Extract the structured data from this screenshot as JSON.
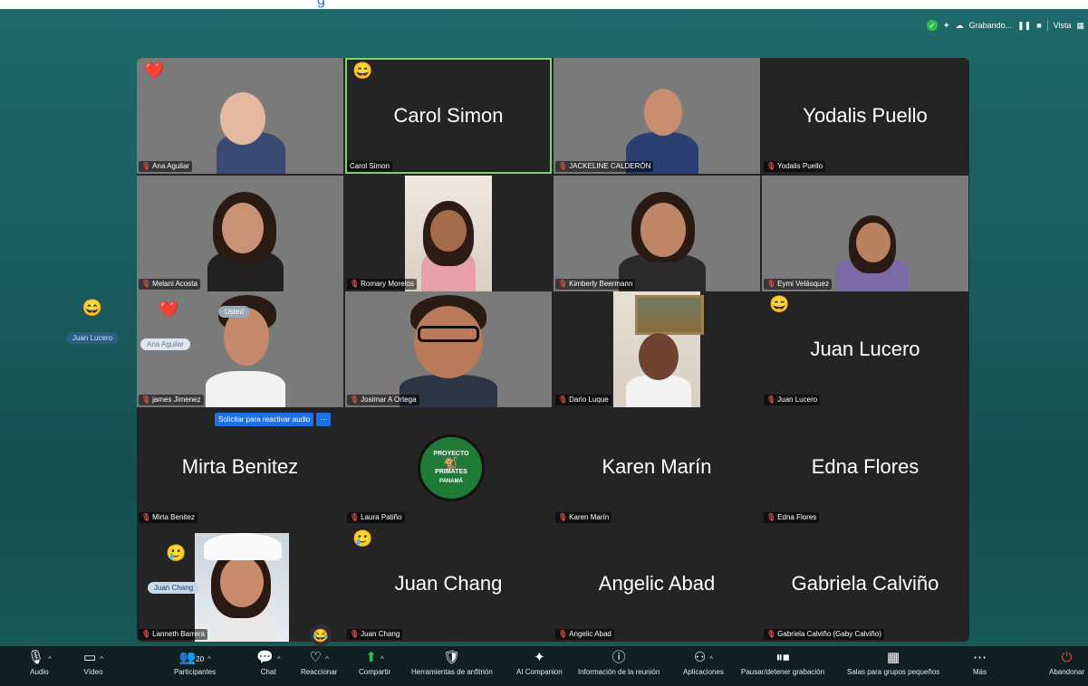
{
  "top_strip": {
    "text": "g"
  },
  "top_bar": {
    "recording_label": "Grabando...",
    "view_label": "Vista"
  },
  "participants": [
    {
      "display": "Ana Aguilar",
      "name": "Ana Aguilar",
      "muted": true,
      "video": true,
      "reaction": "❤️"
    },
    {
      "display": "Carol Simon",
      "name": "Carol Simon",
      "muted": false,
      "video": false,
      "reaction": "😄",
      "speaking": true
    },
    {
      "display": "JACKELINE CALDERÓN",
      "name": "JACKELINE CALDERÓN",
      "muted": true,
      "video": true
    },
    {
      "display": "Yodalis Puello",
      "name": "Yodalis Puello",
      "muted": true,
      "video": false
    },
    {
      "display": "Melani Acosta",
      "name": "Melani Acosta",
      "muted": true,
      "video": true
    },
    {
      "display": "Romary Morelos",
      "name": "Romary Morelos",
      "muted": true,
      "video": true
    },
    {
      "display": "Kimberly Beermann",
      "name": "Kimberly Beermann",
      "muted": true,
      "video": true
    },
    {
      "display": "Eymi Velásquez",
      "name": "Eymi Velásquez",
      "muted": true,
      "video": true
    },
    {
      "display": "james Jimenez",
      "name": "james Jimenez",
      "muted": true,
      "video": true,
      "reaction": "❤️",
      "overlay_top": "Usted",
      "overlay_sub": "Ana Aguilar"
    },
    {
      "display": "Josimar A Ortega",
      "name": "Josimar A Ortega",
      "muted": true,
      "video": true
    },
    {
      "display": "Dario Luque",
      "name": "Dario Luque",
      "muted": true,
      "video": true
    },
    {
      "display": "Juan Lucero",
      "name": "Juan Lucero",
      "muted": true,
      "video": false,
      "reaction": "😄"
    },
    {
      "display": "Mirta Benitez",
      "name": "Mirta Benitez",
      "muted": true,
      "video": false
    },
    {
      "display": "Laura Patiño",
      "name": "Laura Patiño",
      "muted": true,
      "video": false,
      "logo": [
        "PROYECTO",
        "PRIMATES",
        "PANAMÁ"
      ]
    },
    {
      "display": "Karen Marín",
      "name": "Karen Marín",
      "muted": true,
      "video": false
    },
    {
      "display": "Edna Flores",
      "name": "Edna Flores",
      "muted": true,
      "video": false
    },
    {
      "display": "Lanneth Barrera",
      "name": "Lanneth Barrera",
      "muted": true,
      "video": true,
      "reaction": "🥲",
      "overlay_sub": "Juan Chang"
    },
    {
      "display": "Juan Chang",
      "name": "Juan Chang",
      "muted": true,
      "video": false,
      "reaction": "🥲"
    },
    {
      "display": "Angelic Abad",
      "name": "Angelic Abad",
      "muted": true,
      "video": false
    },
    {
      "display": "Gabriela Calviño",
      "name": "Gabriela Calviño (Gaby Calviño)",
      "muted": true,
      "video": false
    }
  ],
  "side_float": {
    "reaction": "😄",
    "name": "Juan Lucero"
  },
  "reactivate_button": {
    "label": "Solicitar para reactivar audio",
    "more": "···"
  },
  "toolbar": {
    "audio": "Audio",
    "video": "Vídeo",
    "participants": "Participantes",
    "participants_count": "20",
    "chat": "Chat",
    "react": "Reaccionar",
    "share": "Compartir",
    "host_tools": "Herramientas de anfitrión",
    "ai_companion": "AI Companion",
    "meeting_info": "Información de la reunión",
    "apps": "Aplicaciones",
    "pause_recording": "Pausar/detener grabación",
    "breakout_rooms": "Salas para grupos pequeños",
    "more": "Más",
    "leave": "Abandonar"
  }
}
